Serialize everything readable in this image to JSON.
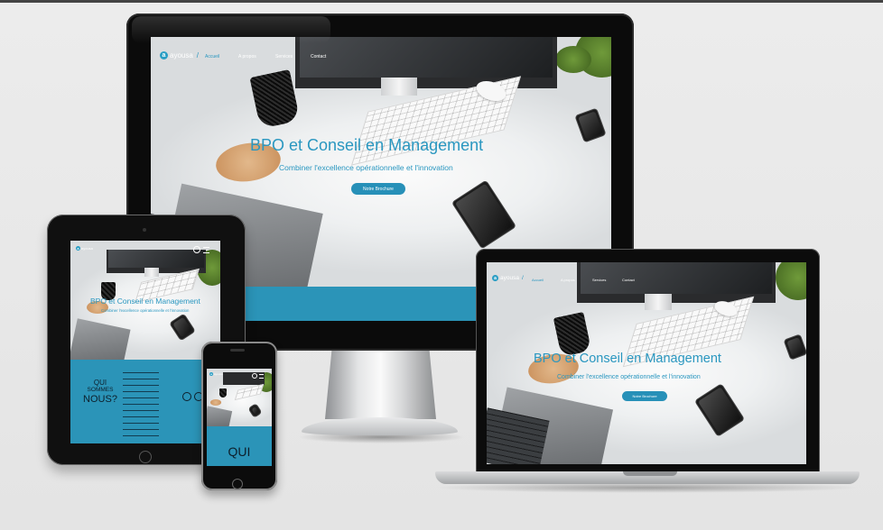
{
  "site": {
    "brand": "ayousa",
    "brand_initial": "a",
    "nav": {
      "home": "Accueil",
      "about": "A propos",
      "services": "Services",
      "contact": "Contact"
    },
    "hero": {
      "title": "BPO et Conseil en Management",
      "subtitle": "Combiner l'excellence opérationnelle et l'innovation",
      "cta": "Notre Brochure"
    },
    "about": {
      "title_line1": "QUI",
      "title_line2": "SOMMES",
      "title_line3": "NOUS?",
      "phone_title": "QUI"
    }
  },
  "colors": {
    "accent": "#2a97c0",
    "teal_section": "#2b94b8",
    "device_black": "#0b0b0b"
  },
  "icons": {
    "logo": "brand-logo-icon",
    "search": "search-icon",
    "menu": "hamburger-menu-icon",
    "facebook": "facebook-icon",
    "instagram": "instagram-icon"
  }
}
